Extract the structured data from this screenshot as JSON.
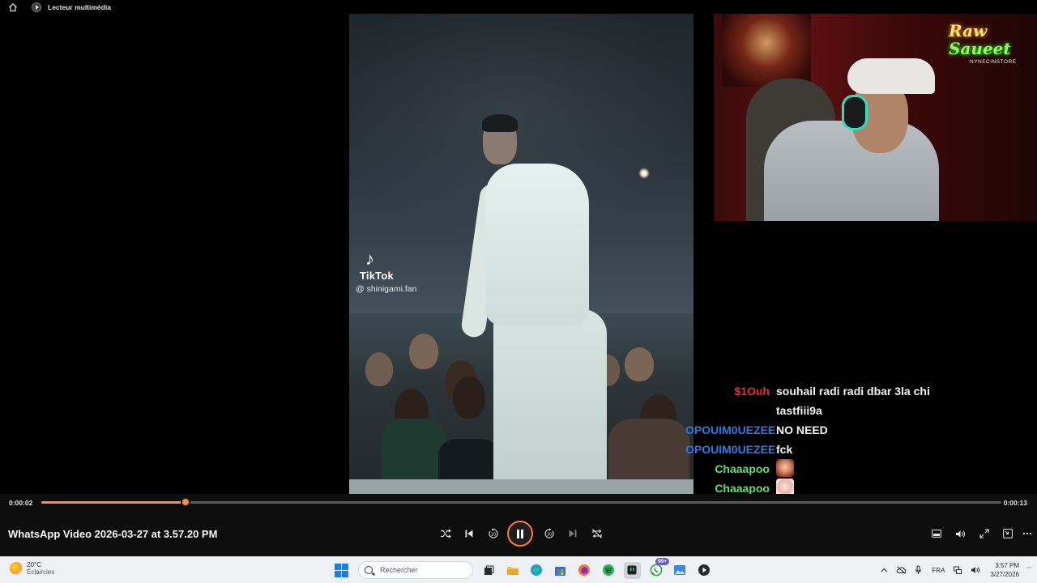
{
  "titlebar": {
    "app_title": "Lecteur multimédia"
  },
  "video": {
    "tiktok_note": "♪",
    "tiktok_brand": "TikTok",
    "tiktok_handle": "@ shinigami.fan",
    "neon_line1": "Raw",
    "neon_line2": "Saueet",
    "neon_sub": "NYNECINSTORE"
  },
  "chat": {
    "messages": [
      {
        "user": "$1Ouh",
        "text": "souhail radi radi dbar 3la chi",
        "color": "#e0323c"
      },
      {
        "user": "",
        "text": "tastfiii9a",
        "color": "#e0323c"
      },
      {
        "user": "OPOUIM0UEZEE",
        "text": "NO NEED",
        "color": "#2c7be5"
      },
      {
        "user": "OPOUIM0UEZEE",
        "text": "fck",
        "color": "#2c7be5"
      },
      {
        "user": "Chaaapoo",
        "text": "",
        "color": "#5ee36a"
      },
      {
        "user": "Chaaapoo",
        "text": "",
        "color": "#5ee36a"
      }
    ]
  },
  "player": {
    "current_time": "0:00:02",
    "duration": "0:00:13",
    "progress_fraction": 0.15,
    "file_title": "WhatsApp Video 2026-03-27 at 3.57.20 PM",
    "accent_color": "#ff8d4a"
  },
  "taskbar": {
    "temperature": "20°C",
    "condition": "Éclaircies",
    "search_placeholder": "Rechercher",
    "badge_count": "99+",
    "language": "FRA",
    "time": "3:57 PM",
    "date": "3/27/2026"
  },
  "icons": {
    "home": "home-icon",
    "shuffle": "shuffle-icon",
    "previous": "previous-icon",
    "rewind": "rewind-10-icon",
    "pause": "pause-icon",
    "forward": "forward-30-icon",
    "next": "next-icon",
    "repeat": "repeat-off-icon",
    "miniplayer": "miniplayer-icon",
    "volume": "volume-icon",
    "fullscreen": "fullscreen-icon",
    "pip": "picture-in-picture-icon",
    "more": "more-icon"
  }
}
